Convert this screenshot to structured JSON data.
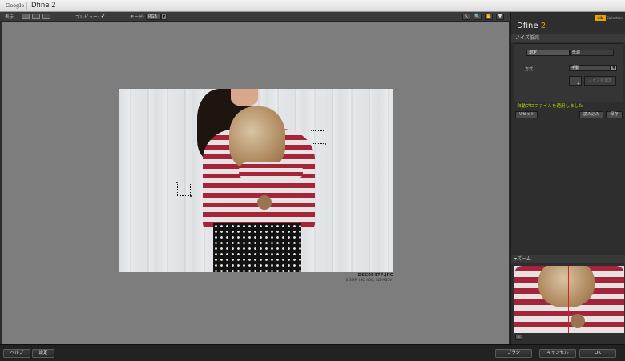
{
  "titlebar": {
    "brand": "Google",
    "app_title": "Dfine 2"
  },
  "toolbar": {
    "view_label": "表示",
    "preview_label": "プレビュー:",
    "preview_check": "✔",
    "mode_label": "モード:",
    "mode_value": "RGB",
    "mode_arrow": "▼",
    "tools": [
      "↖",
      "🔍",
      "✋",
      "▼"
    ]
  },
  "preview": {
    "file_name": "DSC05477.JPG",
    "file_info": "(0.3MP, ISO 400, SLT-A65V)"
  },
  "panel": {
    "title": "Dfine",
    "title_num": "2",
    "brand_badge": "nik",
    "brand_suffix": "Collection",
    "section_title": "ノイズ低減",
    "tab_measure": "測定",
    "tab_reduce": "低減",
    "method_label": "方式",
    "method_value": "手動",
    "method_arrow": "▼",
    "small_button": "+",
    "add_measure_button": "ノイズを測定",
    "auto_profile_text": "自動プロファイルを適用しました",
    "reset_button": "リセット",
    "load_button": "読み込み",
    "save_button": "保存",
    "zoom_header": "▾ズーム",
    "zoom_tool": "↖"
  },
  "footer": {
    "help_button": "ヘルプ",
    "settings_button": "設定",
    "brush_button": "ブラシ",
    "cancel_button": "キャンセル",
    "ok_button": "OK"
  },
  "colors": {
    "accent_title": "#e9a000",
    "status_green": "#b8e300",
    "zoom_line": "#e02020"
  }
}
